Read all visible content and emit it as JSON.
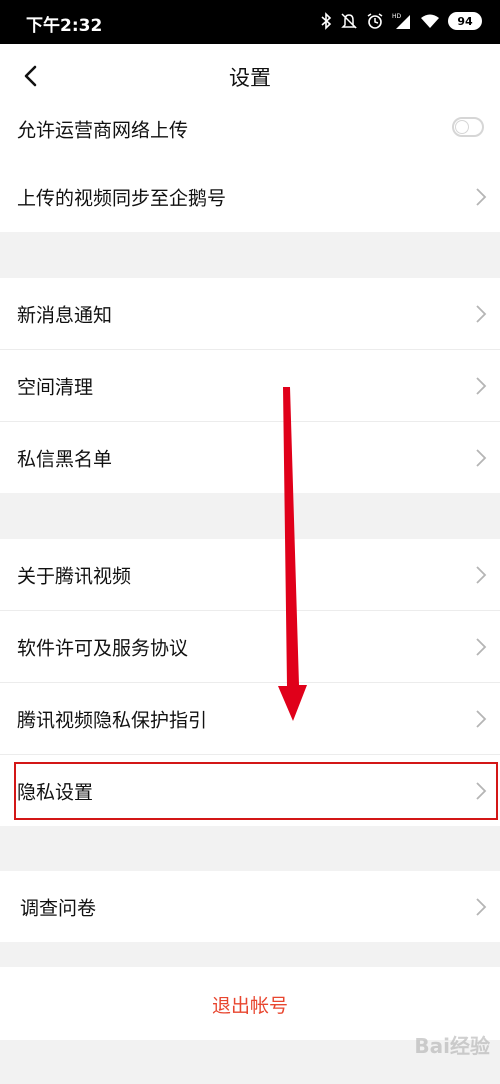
{
  "status_bar": {
    "time": "下午2:32",
    "battery": "94",
    "icons": [
      "bluetooth-icon",
      "mute-icon",
      "alarm-icon",
      "hd-icon",
      "signal-icon",
      "wifi-icon",
      "battery-icon"
    ]
  },
  "header": {
    "title": "设置",
    "back_icon": "chevron-left-icon"
  },
  "sections": [
    {
      "items": [
        {
          "label": "允许运营商网络上传",
          "control": "toggle",
          "toggle_on": false
        },
        {
          "label": "上传的视频同步至企鹅号",
          "control": "chevron"
        }
      ]
    },
    {
      "items": [
        {
          "label": "新消息通知",
          "control": "chevron"
        },
        {
          "label": "空间清理",
          "control": "chevron"
        },
        {
          "label": "私信黑名单",
          "control": "chevron"
        }
      ]
    },
    {
      "items": [
        {
          "label": "关于腾讯视频",
          "control": "chevron"
        },
        {
          "label": "软件许可及服务协议",
          "control": "chevron"
        },
        {
          "label": "腾讯视频隐私保护指引",
          "control": "chevron"
        },
        {
          "label": "隐私设置",
          "control": "chevron",
          "highlighted": true
        }
      ]
    },
    {
      "items": [
        {
          "label": "调查问卷",
          "control": "chevron"
        }
      ]
    }
  ],
  "logout": {
    "label": "退出帐号"
  },
  "annotation": {
    "highlight_color": "#d31717",
    "arrow_color": "#e0001a"
  },
  "colors": {
    "background": "#f2f2f2",
    "row_bg": "#ffffff",
    "logout_text": "#e8462f",
    "chevron": "#b5b5b5"
  },
  "watermark": {
    "text": "Bai经验"
  }
}
